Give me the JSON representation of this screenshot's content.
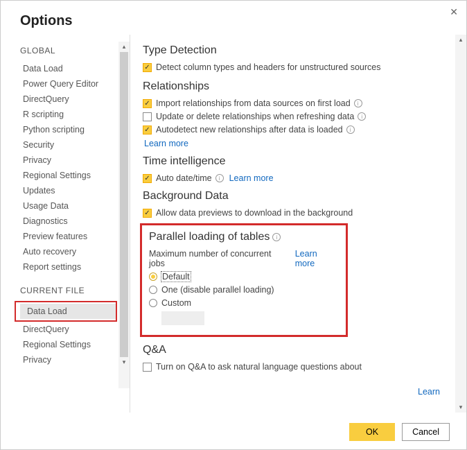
{
  "window": {
    "title": "Options"
  },
  "sidebar": {
    "group1_label": "GLOBAL",
    "group1_items": [
      "Data Load",
      "Power Query Editor",
      "DirectQuery",
      "R scripting",
      "Python scripting",
      "Security",
      "Privacy",
      "Regional Settings",
      "Updates",
      "Usage Data",
      "Diagnostics",
      "Preview features",
      "Auto recovery",
      "Report settings"
    ],
    "group2_label": "CURRENT FILE",
    "group2_items": [
      "Data Load",
      "DirectQuery",
      "Regional Settings",
      "Privacy"
    ]
  },
  "content": {
    "typeDetection": {
      "title": "Type Detection",
      "opt1": "Detect column types and headers for unstructured sources"
    },
    "relationships": {
      "title": "Relationships",
      "opt1": "Import relationships from data sources on first load",
      "opt2": "Update or delete relationships when refreshing data",
      "opt3": "Autodetect new relationships after data is loaded",
      "learn": "Learn more"
    },
    "timeIntel": {
      "title": "Time intelligence",
      "opt1": "Auto date/time",
      "learn": "Learn more"
    },
    "bgData": {
      "title": "Background Data",
      "opt1": "Allow data previews to download in the background"
    },
    "parallel": {
      "title": "Parallel loading of tables",
      "desc": "Maximum number of concurrent jobs",
      "learn": "Learn more",
      "opt_default": "Default",
      "opt_one": "One (disable parallel loading)",
      "opt_custom": "Custom"
    },
    "qa": {
      "title": "Q&A",
      "opt1": "Turn on Q&A to ask natural language questions about",
      "learn": "Learn"
    }
  },
  "footer": {
    "ok": "OK",
    "cancel": "Cancel"
  }
}
